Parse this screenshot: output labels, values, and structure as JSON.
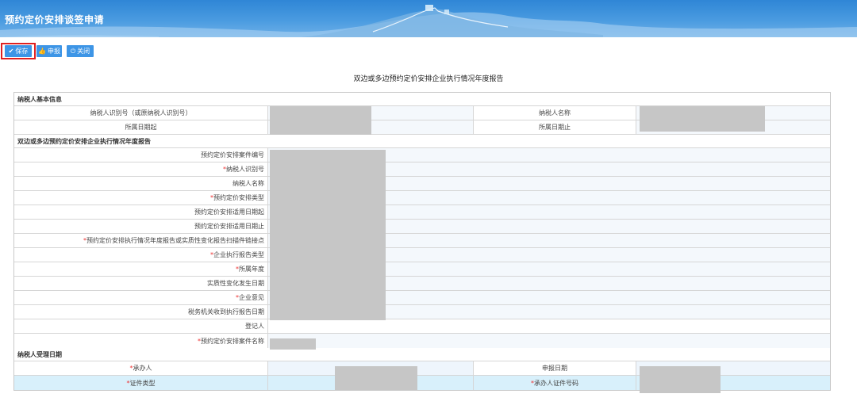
{
  "app": {
    "title": "预约定价安排谈签申请"
  },
  "toolbar": {
    "save_label": "保存",
    "report_label": "申报",
    "close_label": "关闭"
  },
  "report": {
    "title": "双边或多边预约定价安排企业执行情况年度报告"
  },
  "sections": {
    "basic": "纳税人基本信息",
    "annual": "双边或多边预约定价安排企业执行情况年度报告",
    "accept": "纳税人受理日期"
  },
  "basic_fields": {
    "taxpayer_id": "纳税人识别号（或原纳税人识别号）",
    "taxpayer_name": "纳税人名称",
    "period_start": "所属日期起",
    "period_end": "所属日期止"
  },
  "annual_fields": [
    {
      "label": "预约定价安排案件编号",
      "required": false
    },
    {
      "label": "纳税人识别号",
      "required": true
    },
    {
      "label": "纳税人名称",
      "required": false
    },
    {
      "label": "预约定价安排类型",
      "required": true
    },
    {
      "label": "预约定价安排适用日期起",
      "required": false
    },
    {
      "label": "预约定价安排适用日期止",
      "required": false
    },
    {
      "label": "预约定价安排执行情况年度报告或实质性变化报告扫描件链接点",
      "required": true
    },
    {
      "label": "企业执行报告类型",
      "required": true
    },
    {
      "label": "所属年度",
      "required": true
    },
    {
      "label": "实质性变化发生日期",
      "required": false
    },
    {
      "label": "企业意见",
      "required": true
    },
    {
      "label": "税务机关收到执行报告日期",
      "required": false
    },
    {
      "label": "登记人",
      "required": false
    },
    {
      "label": "预约定价安排案件名称",
      "required": true
    }
  ],
  "accept_fields": {
    "handler": "承办人",
    "report_date": "申报日期",
    "id_type": "证件类型",
    "handler_id_no": "承办人证件号码"
  },
  "colors": {
    "banner": "#3a8fdc",
    "button": "#3d95e6",
    "highlight": "#e02020",
    "required": "#e33333"
  }
}
